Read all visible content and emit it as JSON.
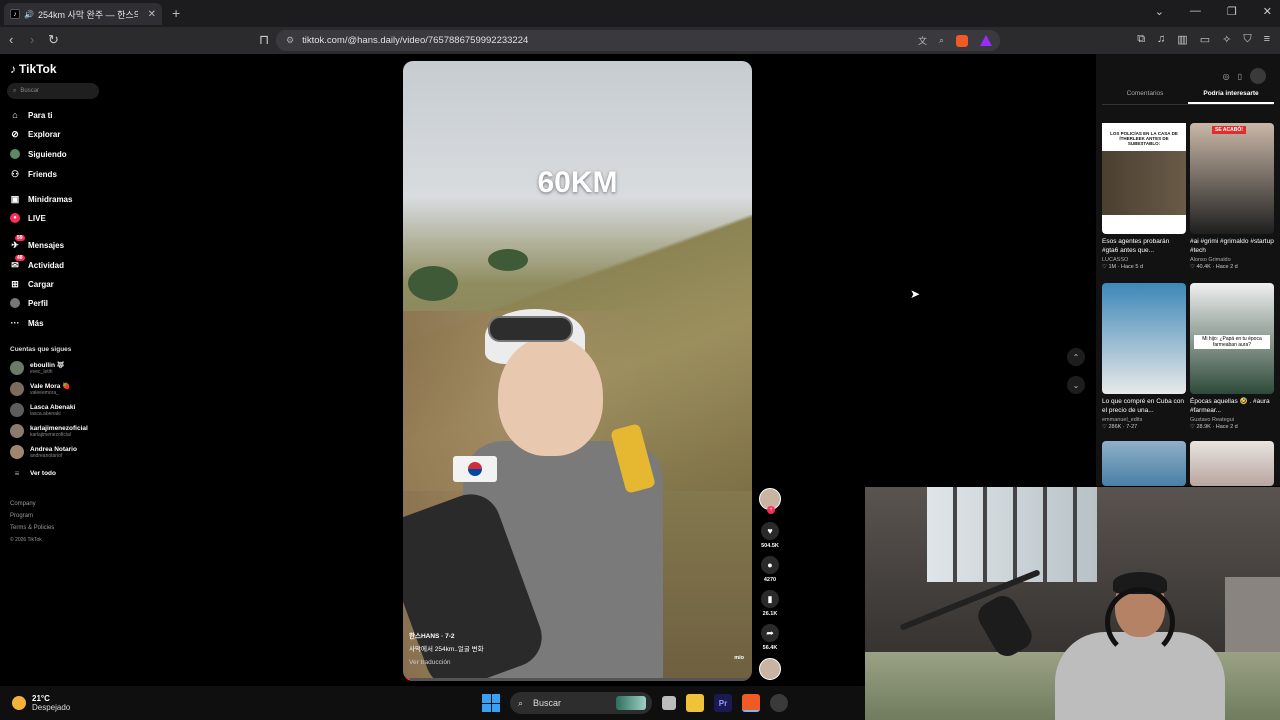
{
  "browser": {
    "tab_title": "254km 사막 완주 — 한스의 ...",
    "url": "tiktok.com/@hans.daily/video/7657886759992233224"
  },
  "sidebar": {
    "logo": "TikTok",
    "search_placeholder": "Buscar",
    "nav": [
      {
        "label": "Para ti",
        "icon": "home-icon"
      },
      {
        "label": "Explorar",
        "icon": "compass-icon"
      },
      {
        "label": "Siguiendo",
        "icon": "following-icon"
      },
      {
        "label": "Friends",
        "icon": "friends-icon"
      },
      {
        "label": "Minidramas",
        "icon": "minidramas-icon"
      },
      {
        "label": "LIVE",
        "icon": "live-icon"
      },
      {
        "label": "Mensajes",
        "icon": "messages-icon",
        "badge": "59"
      },
      {
        "label": "Actividad",
        "icon": "activity-icon",
        "badge": "48"
      },
      {
        "label": "Cargar",
        "icon": "upload-icon"
      },
      {
        "label": "Perfil",
        "icon": "profile-icon"
      },
      {
        "label": "Más",
        "icon": "more-icon"
      }
    ],
    "following_title": "Cuentas que sigues",
    "accounts": [
      {
        "name": "eboullin 🐺",
        "handle": "evec_letih"
      },
      {
        "name": "Vale Mora 🍓",
        "handle": "valeeemora_"
      },
      {
        "name": "Lasca Abenaki",
        "handle": "lasca.abenaki"
      },
      {
        "name": "karlajimenezoficial",
        "handle": "karlajimenezoficial"
      },
      {
        "name": "Andrea Notario",
        "handle": "andreanotariof"
      }
    ],
    "see_all": "Ver todo",
    "footer": [
      "Company",
      "Program",
      "Terms & Policies",
      "© 2026 TikTok"
    ]
  },
  "video": {
    "overlay_text": "60KM",
    "author": "한스HANS · 7-2",
    "caption": "사막에서 254km..얼굴 변화",
    "see_translation": "Ver traducción",
    "music": "mio",
    "progress": 0.02
  },
  "actions": {
    "likes": "504.5K",
    "comments": "4270",
    "saves": "26.1K",
    "shares": "56.4K"
  },
  "right_panel": {
    "tabs": [
      "Comentarios",
      "Podría interesarte"
    ],
    "active_tab": 1,
    "cards": [
      {
        "thumb_label": "LOS POLICÍAS EN LA CASA DE ÍTHERLEEK ANTES DE SUBESTABLO:",
        "title": "Esos agentes probarán #gta6 antes que...",
        "author": "LUCASSO",
        "stats": "♡ 1M · Hace 5 d"
      },
      {
        "thumb_label": "SE ACABÓ!",
        "title": "#ai #grimi #grimaldo #startup #tech",
        "author": "Alonso Grimaldo",
        "stats": "♡ 40.4K · Hace 2 d"
      },
      {
        "thumb_label": "",
        "title": "Lo que compré en Cuba con el precio de una...",
        "author": "emmanuel_edits",
        "stats": "♡ 286K · 7-27"
      },
      {
        "thumb_label": "Mi hijo: ¿Papá en tu época farmeaban aura?",
        "title": "Épocas aquellas 🤣 . #aura #farmear...",
        "author": "Gustavo Reategui",
        "stats": "♡ 28.9K · Hace 2 d"
      }
    ]
  },
  "taskbar": {
    "temp": "21°C",
    "condition": "Despejado",
    "search_label": "Buscar"
  }
}
